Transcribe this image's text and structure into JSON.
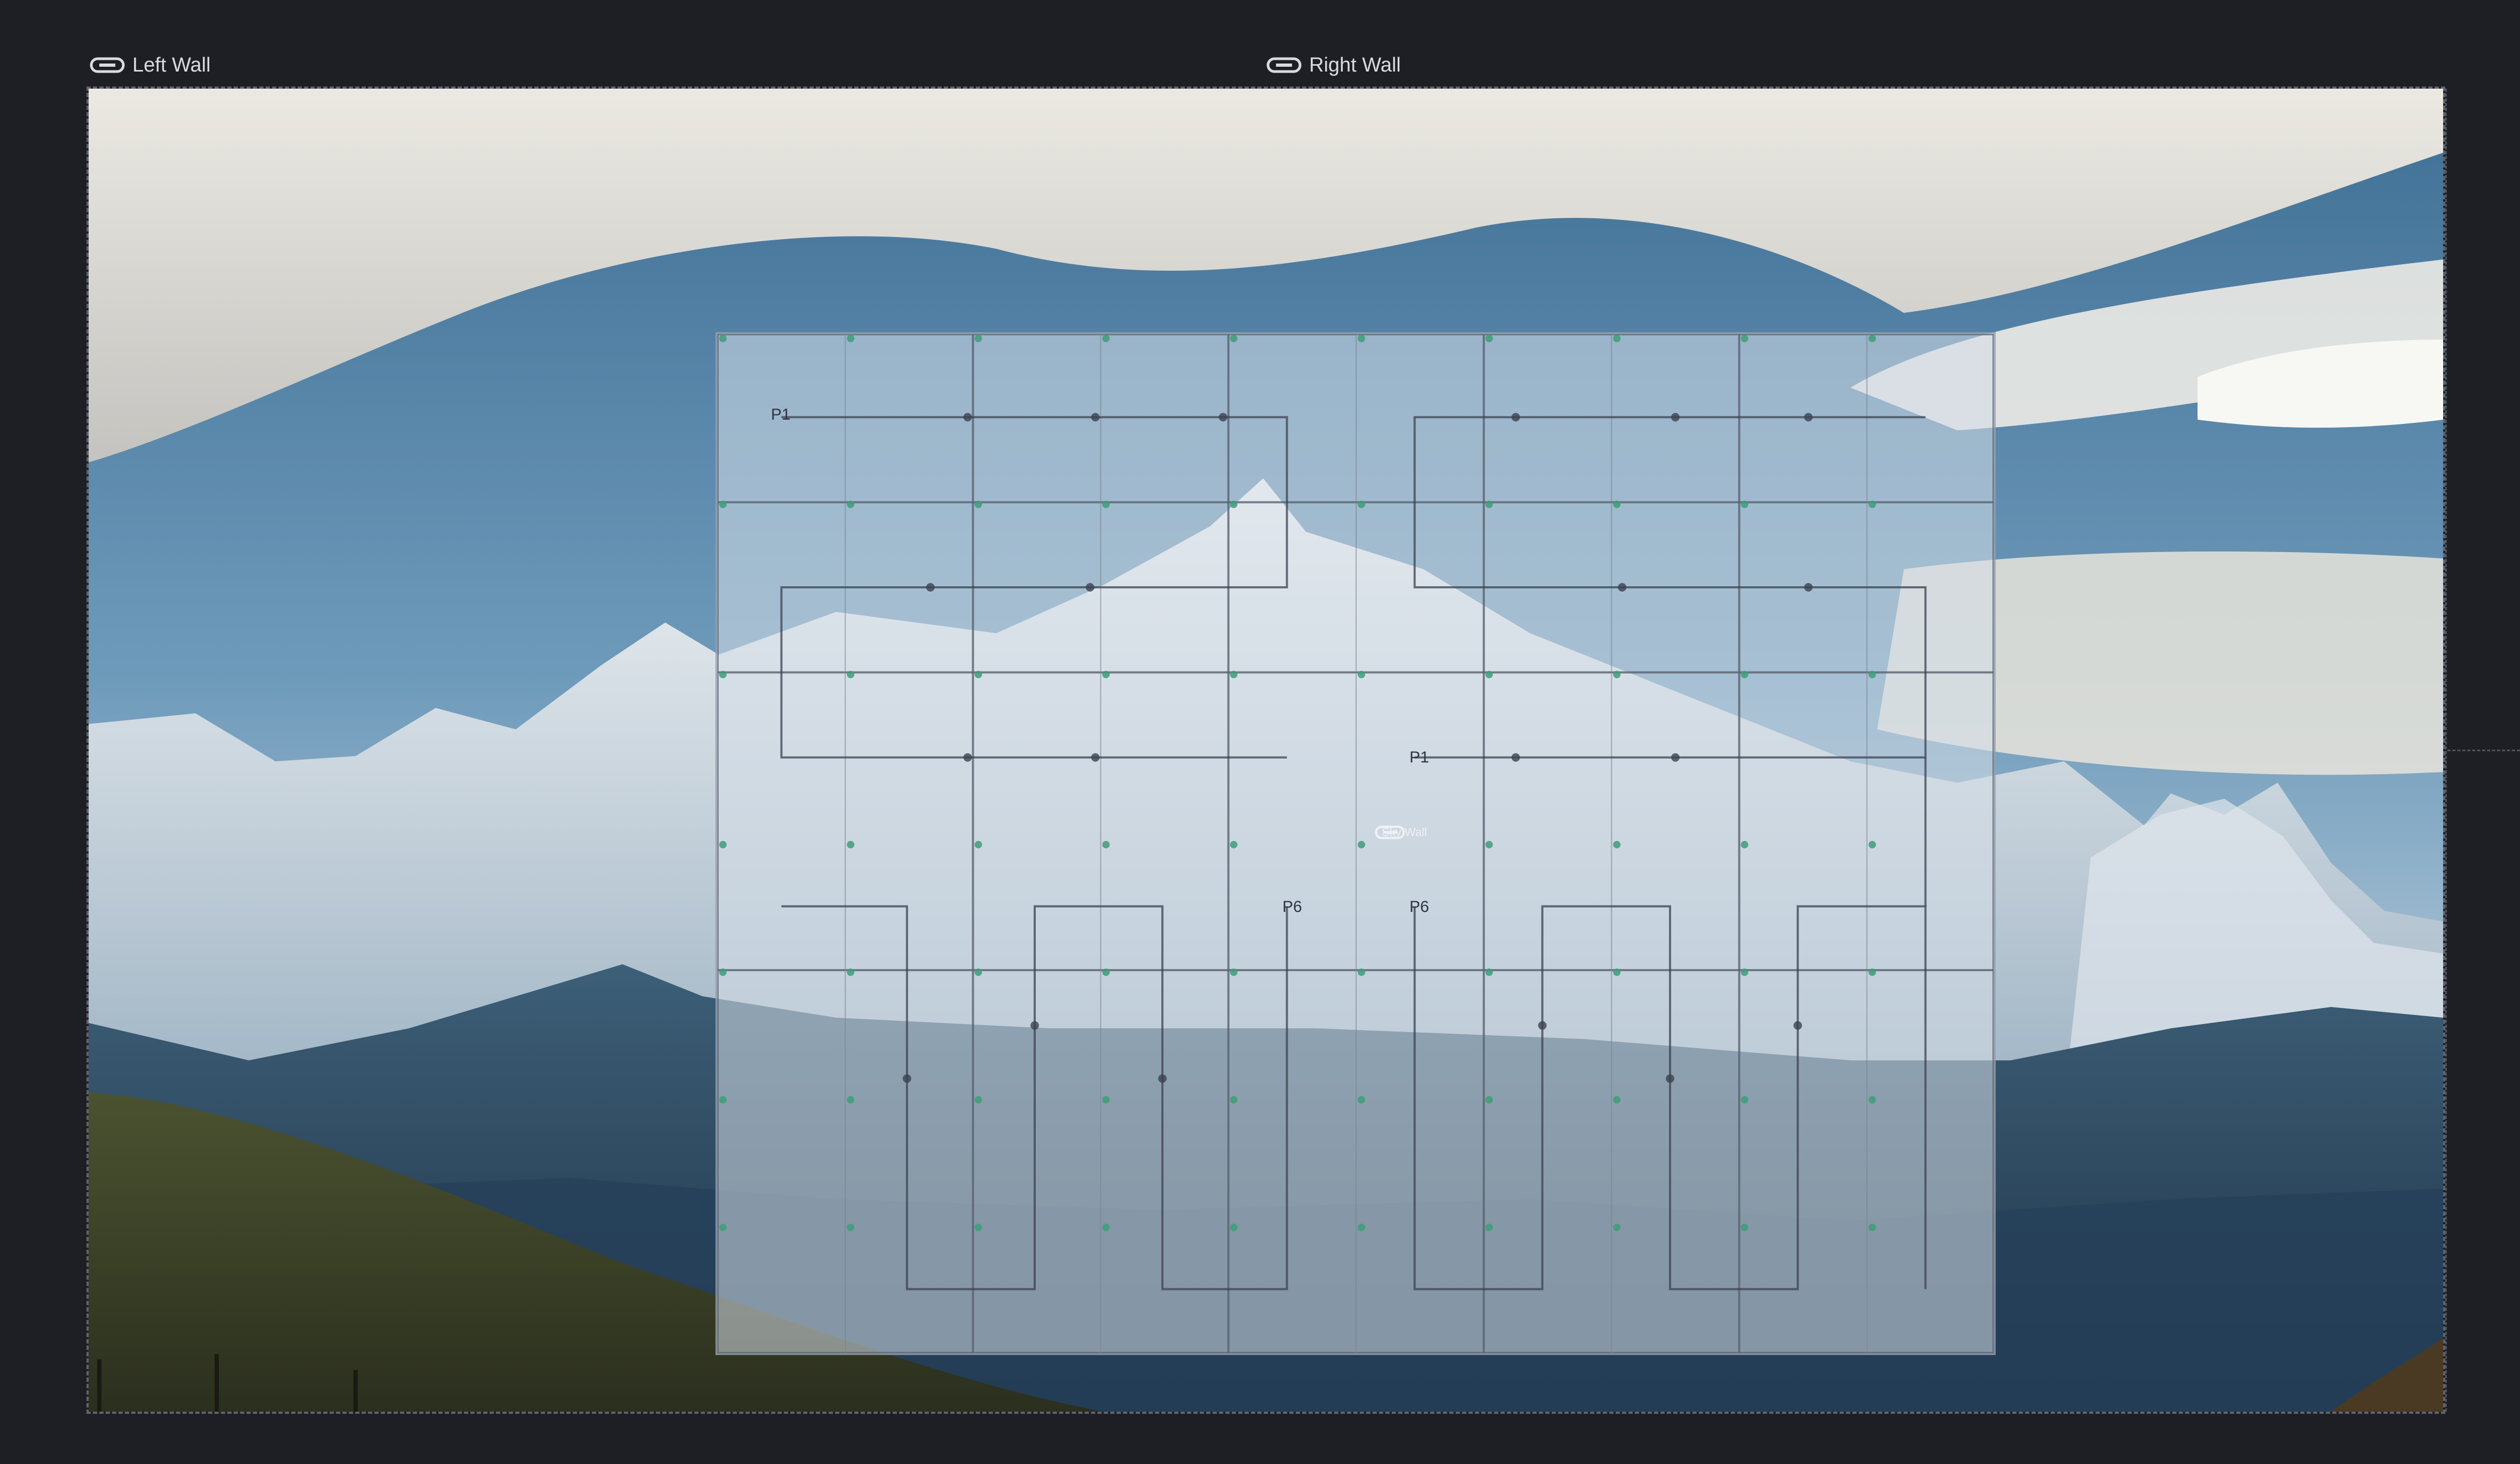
{
  "walls": {
    "left": {
      "label": "Left Wall",
      "icon": "link-icon"
    },
    "right": {
      "label": "Right Wall",
      "icon": "link-icon"
    }
  },
  "panel_grid": {
    "center_tag": "Sky Wall",
    "port_labels": [
      "P1",
      "P1",
      "P6",
      "P6"
    ]
  },
  "colors": {
    "background": "#1e1f24",
    "label_text": "#d8dbe2",
    "grid_overlay": "#d6dee8",
    "route_line": "#3b4250",
    "node_dot": "#3d9e78"
  }
}
